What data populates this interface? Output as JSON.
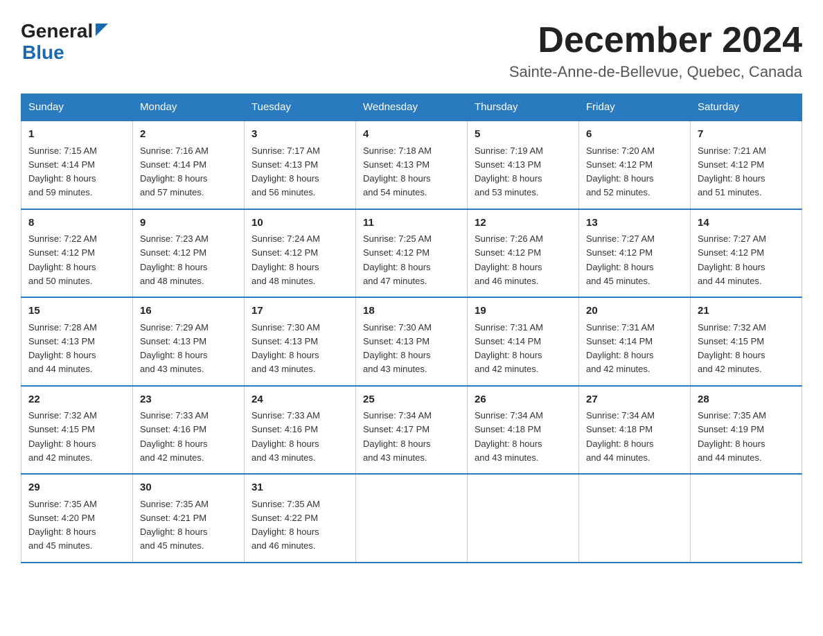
{
  "header": {
    "logo_general": "General",
    "logo_blue": "Blue",
    "month_title": "December 2024",
    "location": "Sainte-Anne-de-Bellevue, Quebec, Canada"
  },
  "weekdays": [
    "Sunday",
    "Monday",
    "Tuesday",
    "Wednesday",
    "Thursday",
    "Friday",
    "Saturday"
  ],
  "weeks": [
    [
      {
        "day": "1",
        "sunrise": "7:15 AM",
        "sunset": "4:14 PM",
        "daylight": "8 hours and 59 minutes."
      },
      {
        "day": "2",
        "sunrise": "7:16 AM",
        "sunset": "4:14 PM",
        "daylight": "8 hours and 57 minutes."
      },
      {
        "day": "3",
        "sunrise": "7:17 AM",
        "sunset": "4:13 PM",
        "daylight": "8 hours and 56 minutes."
      },
      {
        "day": "4",
        "sunrise": "7:18 AM",
        "sunset": "4:13 PM",
        "daylight": "8 hours and 54 minutes."
      },
      {
        "day": "5",
        "sunrise": "7:19 AM",
        "sunset": "4:13 PM",
        "daylight": "8 hours and 53 minutes."
      },
      {
        "day": "6",
        "sunrise": "7:20 AM",
        "sunset": "4:12 PM",
        "daylight": "8 hours and 52 minutes."
      },
      {
        "day": "7",
        "sunrise": "7:21 AM",
        "sunset": "4:12 PM",
        "daylight": "8 hours and 51 minutes."
      }
    ],
    [
      {
        "day": "8",
        "sunrise": "7:22 AM",
        "sunset": "4:12 PM",
        "daylight": "8 hours and 50 minutes."
      },
      {
        "day": "9",
        "sunrise": "7:23 AM",
        "sunset": "4:12 PM",
        "daylight": "8 hours and 48 minutes."
      },
      {
        "day": "10",
        "sunrise": "7:24 AM",
        "sunset": "4:12 PM",
        "daylight": "8 hours and 48 minutes."
      },
      {
        "day": "11",
        "sunrise": "7:25 AM",
        "sunset": "4:12 PM",
        "daylight": "8 hours and 47 minutes."
      },
      {
        "day": "12",
        "sunrise": "7:26 AM",
        "sunset": "4:12 PM",
        "daylight": "8 hours and 46 minutes."
      },
      {
        "day": "13",
        "sunrise": "7:27 AM",
        "sunset": "4:12 PM",
        "daylight": "8 hours and 45 minutes."
      },
      {
        "day": "14",
        "sunrise": "7:27 AM",
        "sunset": "4:12 PM",
        "daylight": "8 hours and 44 minutes."
      }
    ],
    [
      {
        "day": "15",
        "sunrise": "7:28 AM",
        "sunset": "4:13 PM",
        "daylight": "8 hours and 44 minutes."
      },
      {
        "day": "16",
        "sunrise": "7:29 AM",
        "sunset": "4:13 PM",
        "daylight": "8 hours and 43 minutes."
      },
      {
        "day": "17",
        "sunrise": "7:30 AM",
        "sunset": "4:13 PM",
        "daylight": "8 hours and 43 minutes."
      },
      {
        "day": "18",
        "sunrise": "7:30 AM",
        "sunset": "4:13 PM",
        "daylight": "8 hours and 43 minutes."
      },
      {
        "day": "19",
        "sunrise": "7:31 AM",
        "sunset": "4:14 PM",
        "daylight": "8 hours and 42 minutes."
      },
      {
        "day": "20",
        "sunrise": "7:31 AM",
        "sunset": "4:14 PM",
        "daylight": "8 hours and 42 minutes."
      },
      {
        "day": "21",
        "sunrise": "7:32 AM",
        "sunset": "4:15 PM",
        "daylight": "8 hours and 42 minutes."
      }
    ],
    [
      {
        "day": "22",
        "sunrise": "7:32 AM",
        "sunset": "4:15 PM",
        "daylight": "8 hours and 42 minutes."
      },
      {
        "day": "23",
        "sunrise": "7:33 AM",
        "sunset": "4:16 PM",
        "daylight": "8 hours and 42 minutes."
      },
      {
        "day": "24",
        "sunrise": "7:33 AM",
        "sunset": "4:16 PM",
        "daylight": "8 hours and 43 minutes."
      },
      {
        "day": "25",
        "sunrise": "7:34 AM",
        "sunset": "4:17 PM",
        "daylight": "8 hours and 43 minutes."
      },
      {
        "day": "26",
        "sunrise": "7:34 AM",
        "sunset": "4:18 PM",
        "daylight": "8 hours and 43 minutes."
      },
      {
        "day": "27",
        "sunrise": "7:34 AM",
        "sunset": "4:18 PM",
        "daylight": "8 hours and 44 minutes."
      },
      {
        "day": "28",
        "sunrise": "7:35 AM",
        "sunset": "4:19 PM",
        "daylight": "8 hours and 44 minutes."
      }
    ],
    [
      {
        "day": "29",
        "sunrise": "7:35 AM",
        "sunset": "4:20 PM",
        "daylight": "8 hours and 45 minutes."
      },
      {
        "day": "30",
        "sunrise": "7:35 AM",
        "sunset": "4:21 PM",
        "daylight": "8 hours and 45 minutes."
      },
      {
        "day": "31",
        "sunrise": "7:35 AM",
        "sunset": "4:22 PM",
        "daylight": "8 hours and 46 minutes."
      },
      null,
      null,
      null,
      null
    ]
  ],
  "labels": {
    "sunrise": "Sunrise:",
    "sunset": "Sunset:",
    "daylight": "Daylight:"
  }
}
